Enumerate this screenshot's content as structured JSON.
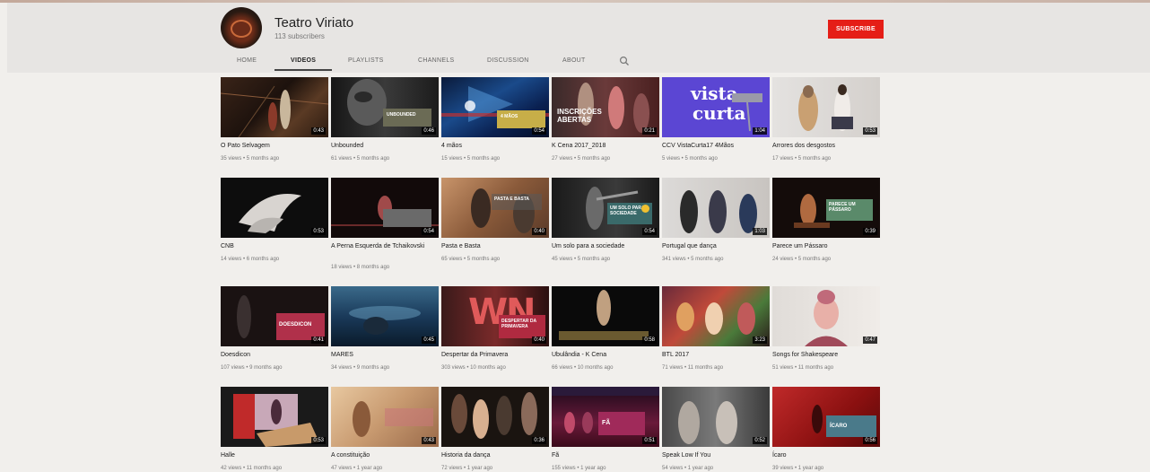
{
  "channel": {
    "name": "Teatro Viriato",
    "subscribers": "113 subscribers",
    "subscribe_label": "SUBSCRIBE"
  },
  "tabs": [
    {
      "label": "HOME"
    },
    {
      "label": "VIDEOS"
    },
    {
      "label": "PLAYLISTS"
    },
    {
      "label": "CHANNELS"
    },
    {
      "label": "DISCUSSION"
    },
    {
      "label": "ABOUT"
    }
  ],
  "active_tab": "VIDEOS",
  "colors": {
    "accent": "#e51e17",
    "background": "#f1efec",
    "header": "#e7e5e3"
  },
  "videos": [
    {
      "title": "O Pato Selvagem",
      "meta": "35 views • 5 months ago",
      "duration": "0:43"
    },
    {
      "title": "Unbounded",
      "meta": "61 views • 5 months ago",
      "duration": "0:46"
    },
    {
      "title": "4 mãos",
      "meta": "15 views • 5 months ago",
      "duration": "0:54"
    },
    {
      "title": "K Cena 2017_2018",
      "meta": "27 views • 5 months ago",
      "duration": "0:21"
    },
    {
      "title": "CCV VistaCurta17 4Mãos",
      "meta": "5 views • 5 months ago",
      "duration": "1:04"
    },
    {
      "title": "Arrores dos desgostos",
      "meta": "17 views • 5 months ago",
      "duration": "0:53"
    },
    {
      "title": "CNB",
      "meta": "14 views • 6 months ago",
      "duration": "0:53"
    },
    {
      "title": "A Perna Esquerda de Tchaikovski",
      "meta": "18 views • 8 months ago",
      "duration": "0:54"
    },
    {
      "title": "Pasta e Basta",
      "meta": "65 views • 5 months ago",
      "duration": "0:40"
    },
    {
      "title": "Um solo para a sociedade",
      "meta": "45 views • 5 months ago",
      "duration": "0:54"
    },
    {
      "title": "Portugal que dança",
      "meta": "341 views • 5 months ago",
      "duration": "1:03"
    },
    {
      "title": "Parece um Pássaro",
      "meta": "24 views • 5 months ago",
      "duration": "0:39"
    },
    {
      "title": "Doesdicon",
      "meta": "107 views • 9 months ago",
      "duration": "0:41"
    },
    {
      "title": "MARES",
      "meta": "34 views • 9 months ago",
      "duration": "0:45"
    },
    {
      "title": "Despertar da Primavera",
      "meta": "303 views • 10 months ago",
      "duration": "0:40"
    },
    {
      "title": "Ubulândia - K Cena",
      "meta": "66 views • 10 months ago",
      "duration": "0:58"
    },
    {
      "title": "BTL 2017",
      "meta": "71 views • 11 months ago",
      "duration": "3:23"
    },
    {
      "title": "Songs for Shakespeare",
      "meta": "51 views • 11 months ago",
      "duration": "0:47"
    },
    {
      "title": "Halle",
      "meta": "42 views • 11 months ago",
      "duration": "0:53"
    },
    {
      "title": "A constituição",
      "meta": "47 views • 1 year ago",
      "duration": "0:43"
    },
    {
      "title": "Historia da dança",
      "meta": "72 views • 1 year ago",
      "duration": "0:36"
    },
    {
      "title": "Fã",
      "meta": "155 views • 1 year ago",
      "duration": "0:51"
    },
    {
      "title": "Speak Low If You",
      "meta": "54 views • 1 year ago",
      "duration": "0:52"
    },
    {
      "title": "Ícaro",
      "meta": "39 views • 1 year ago",
      "duration": "0:56"
    }
  ],
  "thumb_texts": {
    "unbounded": "UNBOUNDED",
    "maos": "4 MÃOS",
    "inscricoes": "INSCRIÇÕES ABERTAS",
    "vista": "vista",
    "curta": "curta",
    "pasta": "PASTA E BASTA",
    "solo": "UM SOLO PARA A SOCIEDADE",
    "passaro": "PARECE UM PÁSSARO",
    "doesdicon": "DOESDICON",
    "despertar": "DESPERTAR DA PRIMAVERA",
    "icaro": "ÍCARO",
    "fa": "FÃ"
  }
}
